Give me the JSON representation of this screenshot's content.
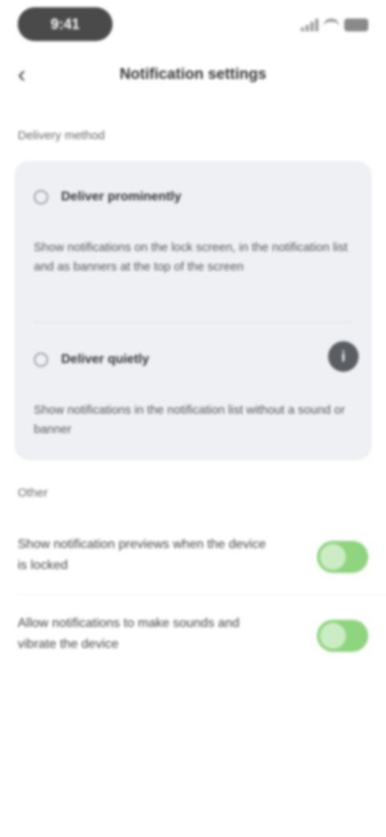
{
  "status_bar": {
    "time": "9:41"
  },
  "nav": {
    "title": "Notification settings"
  },
  "sections": {
    "delivery_header": "Delivery method",
    "other_header": "Other"
  },
  "options": [
    {
      "title": "Deliver prominently",
      "description": "Show notifications on the lock screen, in the notification list and as banners at the top of the screen"
    },
    {
      "title": "Deliver quietly",
      "description": "Show notifications in the notification list without a sound or banner"
    }
  ],
  "settings": [
    {
      "label": "Show notification previews when the device is locked",
      "enabled": true
    },
    {
      "label": "Allow notifications to make sounds and vibrate the device",
      "enabled": true
    }
  ],
  "icons": {
    "back": "chevron-left-icon",
    "info": "info-icon"
  },
  "colors": {
    "toggle_on": "#8fd47f",
    "card_bg": "#eef0f4"
  }
}
